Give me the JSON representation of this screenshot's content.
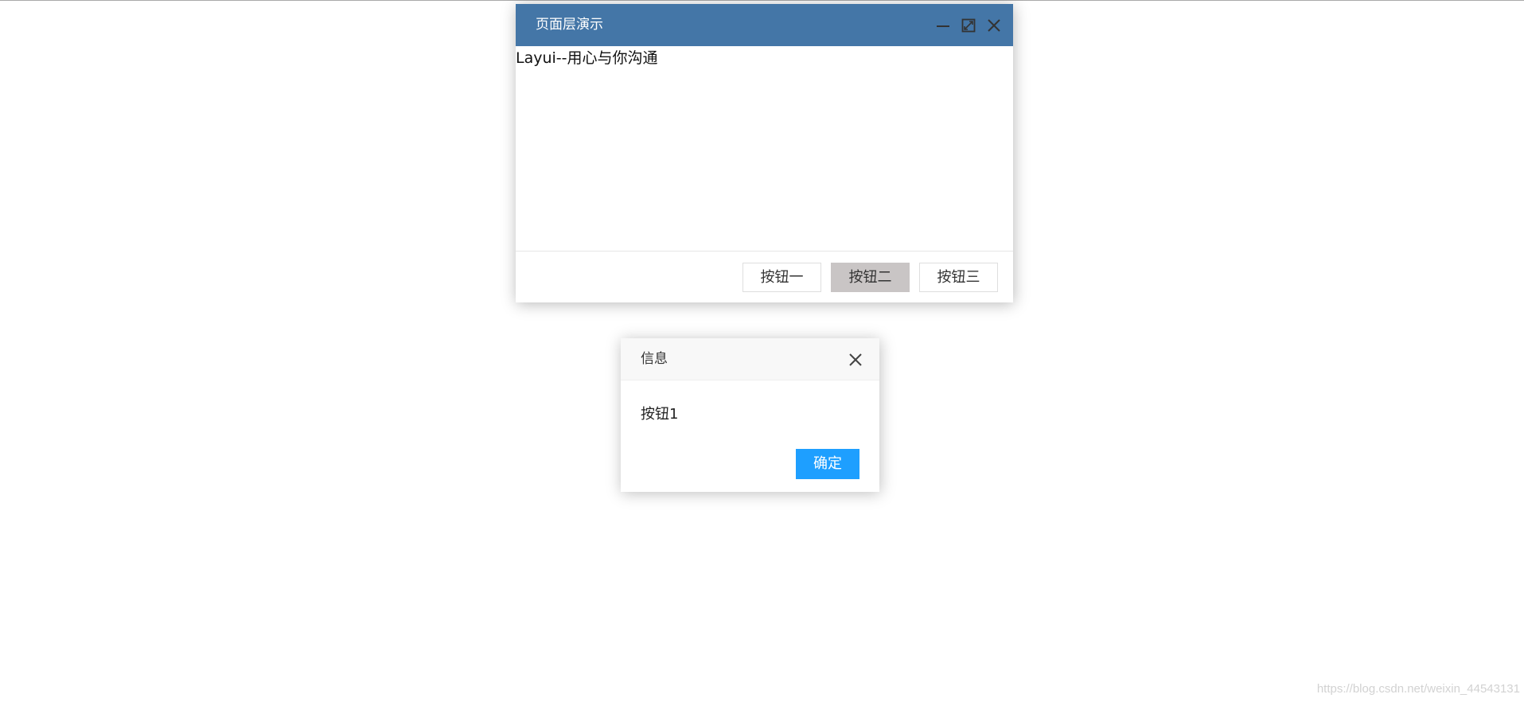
{
  "layer": {
    "title": "页面层演示",
    "content": "Layui--用心与你沟通",
    "buttons": [
      "按钮一",
      "按钮二",
      "按钮三"
    ],
    "controls": {
      "minimize_icon": "minimize-icon",
      "maximize_icon": "maximize-icon",
      "close_icon": "close-icon"
    },
    "title_color": "#4476a7"
  },
  "info": {
    "title": "信息",
    "message": "按钮1",
    "confirm_label": "确定",
    "accent_color": "#1e9fff"
  },
  "watermark": "https://blog.csdn.net/weixin_44543131"
}
